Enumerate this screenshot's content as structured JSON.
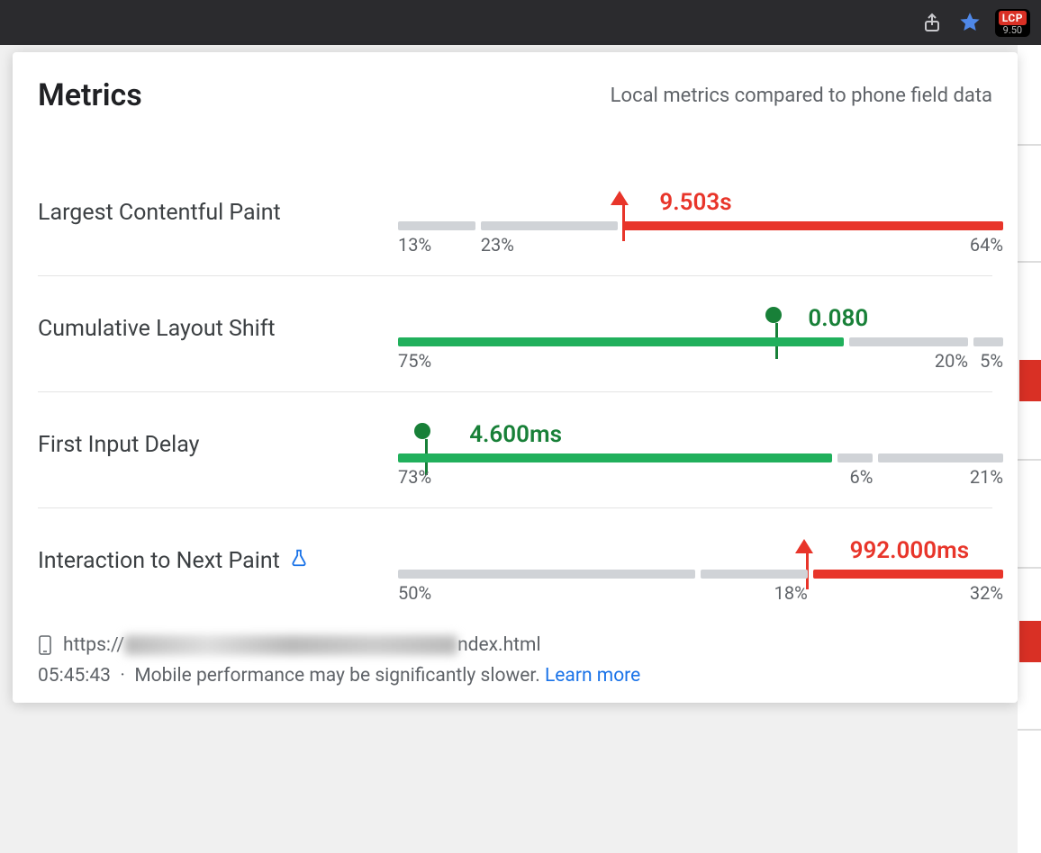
{
  "toolbar": {
    "lcp_badge": "LCP",
    "lcp_value": "9.50"
  },
  "panel": {
    "title": "Metrics",
    "subtitle": "Local metrics compared to phone field data"
  },
  "metrics": [
    {
      "name": "Largest Contentful Paint",
      "value": "9.503s",
      "status": "red",
      "marker": "tri",
      "marker_pos_pct": 37,
      "value_label_left_pct": 44,
      "segments": [
        {
          "pct": 13,
          "label": "13%",
          "color": "grey",
          "label_align": "left"
        },
        {
          "pct": 23,
          "label": "23%",
          "color": "grey",
          "label_align": "left"
        },
        {
          "pct": 64,
          "label": "64%",
          "color": "red",
          "label_align": "right"
        }
      ]
    },
    {
      "name": "Cumulative Layout Shift",
      "value": "0.080",
      "status": "green",
      "marker": "dot",
      "marker_pos_pct": 63,
      "value_label_left_pct": 69,
      "segments": [
        {
          "pct": 75,
          "label": "75%",
          "color": "green",
          "label_align": "left"
        },
        {
          "pct": 20,
          "label": "20%",
          "color": "grey",
          "label_align": "right"
        },
        {
          "pct": 5,
          "label": "5%",
          "color": "grey",
          "label_align": "right"
        }
      ]
    },
    {
      "name": "First Input Delay",
      "value": "4.600ms",
      "status": "green",
      "marker": "dot",
      "marker_pos_pct": 4,
      "value_label_left_pct": 12,
      "segments": [
        {
          "pct": 73,
          "label": "73%",
          "color": "green",
          "label_align": "left"
        },
        {
          "pct": 6,
          "label": "6%",
          "color": "grey",
          "label_align": "right"
        },
        {
          "pct": 21,
          "label": "21%",
          "color": "grey",
          "label_align": "right"
        }
      ]
    },
    {
      "name": "Interaction to Next Paint",
      "experimental": true,
      "value": "992.000ms",
      "status": "red",
      "marker": "tri",
      "marker_pos_pct": 68,
      "value_label_left_pct": 76,
      "segments": [
        {
          "pct": 50,
          "label": "50%",
          "color": "grey",
          "label_align": "left"
        },
        {
          "pct": 18,
          "label": "18%",
          "color": "grey",
          "label_align": "right"
        },
        {
          "pct": 32,
          "label": "32%",
          "color": "red",
          "label_align": "right"
        }
      ]
    }
  ],
  "footer": {
    "url_prefix": "https://",
    "url_suffix": "ndex.html",
    "time": "05:45:43",
    "note": "Mobile performance may be significantly slower.",
    "learn_more": "Learn more"
  }
}
